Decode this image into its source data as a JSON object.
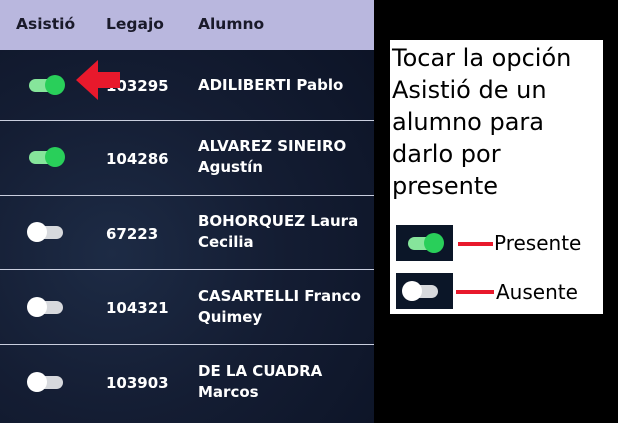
{
  "table": {
    "headers": {
      "asistio": "Asistió",
      "legajo": "Legajo",
      "alumno": "Alumno"
    },
    "rows": [
      {
        "asistio": true,
        "legajo": "103295",
        "alumno": "ADILIBERTI Pablo"
      },
      {
        "asistio": true,
        "legajo": "104286",
        "alumno": "ALVAREZ SINEIRO Agustín"
      },
      {
        "asistio": false,
        "legajo": "67223",
        "alumno": "BOHORQUEZ Laura Cecilia"
      },
      {
        "asistio": false,
        "legajo": "104321",
        "alumno": "CASARTELLI Franco Quimey"
      },
      {
        "asistio": false,
        "legajo": "103903",
        "alumno": "DE LA CUADRA Marcos"
      }
    ]
  },
  "instructions": {
    "text": "Tocar la opción Asistió de un alumno para darlo por presente",
    "legend": {
      "presente": "Presente",
      "ausente": "Ausente"
    }
  },
  "colors": {
    "header_bg": "#b9b7de",
    "toggle_on": "#29cf5a",
    "toggle_off": "#ffffff",
    "arrow": "#e8192c",
    "background": "#141d33"
  },
  "icons": {
    "pointer": "red-arrow-icon"
  }
}
